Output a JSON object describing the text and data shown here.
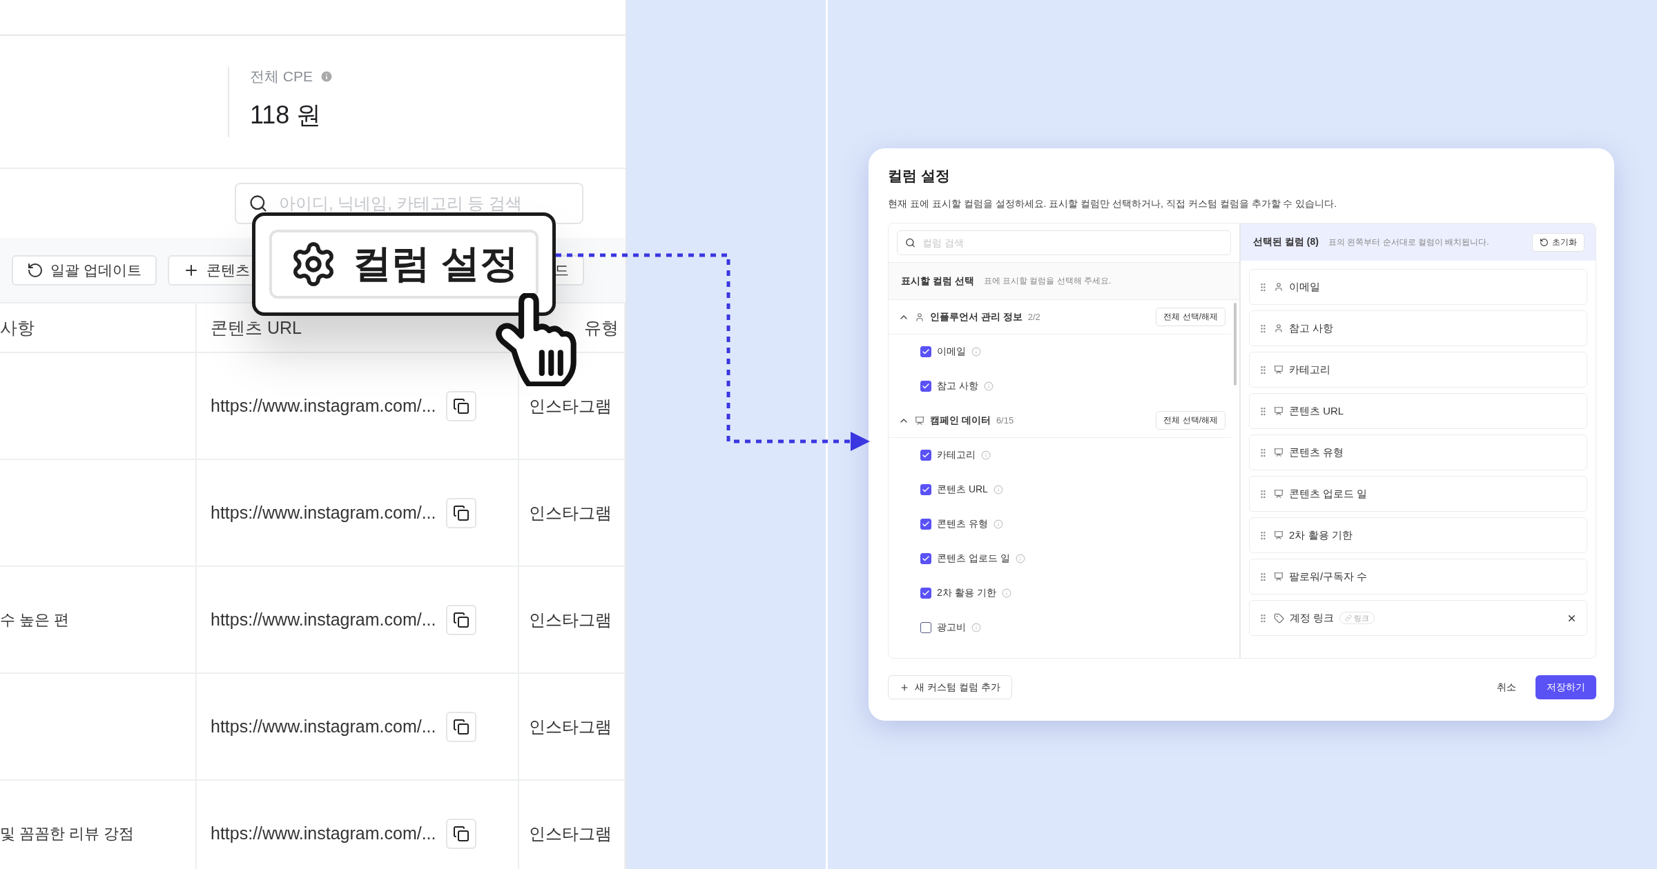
{
  "table_view": {
    "stat": {
      "label": "전체 CPE",
      "value": "118 원"
    },
    "search": {
      "placeholder": "아이디, 닉네임, 카테고리 등 검색"
    },
    "toolbar": [
      {
        "label": "일괄 업데이트",
        "kind": "refresh"
      },
      {
        "label": "콘텐츠",
        "kind": "add"
      },
      {
        "label": "드",
        "kind": "plain"
      }
    ],
    "columns": [
      "사항",
      "콘텐츠 URL",
      "유형"
    ],
    "rows": [
      {
        "url": "https://www.instagram.com/...",
        "type": "인스타그램"
      },
      {
        "url": "https://www.instagram.com/...",
        "type": "인스타그램"
      },
      {
        "note": "수 높은 편",
        "url": "https://www.instagram.com/...",
        "type": "인스타그램"
      },
      {
        "url": "https://www.instagram.com/...",
        "type": "인스타그램"
      },
      {
        "note": "및 꼼꼼한 리뷰 강점",
        "url": "https://www.instagram.com/...",
        "type": "인스타그램"
      }
    ]
  },
  "callout": {
    "label": "컬럼 설정"
  },
  "modal": {
    "title": "컬럼 설정",
    "description": "현재 표에 표시할 컬럼을 설정하세요. 표시할 컬럼만 선택하거나, 직접 커스텀 컬럼을 추가할 수 있습니다.",
    "search": {
      "placeholder": "컬럼 검색"
    },
    "available": {
      "title": "표시할 컬럼 선택",
      "hint": "표에 표시할 컬럼을 선택해 주세요.",
      "groups": [
        {
          "name": "인플루언서 관리 정보",
          "kind": "influencer",
          "count": "2/2",
          "expanded": true,
          "toggle_label": "전체 선택/해제",
          "items": [
            {
              "label": "이메일",
              "checked": true
            },
            {
              "label": "참고 사항",
              "checked": true
            }
          ]
        },
        {
          "name": "캠페인 데이터",
          "kind": "campaign",
          "count": "6/15",
          "expanded": true,
          "toggle_label": "전체 선택/해제",
          "items": [
            {
              "label": "카테고리",
              "checked": true
            },
            {
              "label": "콘텐츠 URL",
              "checked": true
            },
            {
              "label": "콘텐츠 유형",
              "checked": true
            },
            {
              "label": "콘텐츠 업로드 일",
              "checked": true
            },
            {
              "label": "2차 활용 기한",
              "checked": true
            },
            {
              "label": "광고비",
              "checked": false
            }
          ]
        }
      ]
    },
    "selected": {
      "title": "선택된 컬럼 (8)",
      "hint": "표의 왼쪽부터 순서대로 컬럼이 배치됩니다.",
      "reset_label": "초기화",
      "items": [
        {
          "label": "이메일",
          "kind": "influencer"
        },
        {
          "label": "참고 사항",
          "kind": "influencer"
        },
        {
          "label": "카테고리",
          "kind": "campaign"
        },
        {
          "label": "콘텐츠 URL",
          "kind": "campaign"
        },
        {
          "label": "콘텐츠 유형",
          "kind": "campaign"
        },
        {
          "label": "콘텐츠 업로드 일",
          "kind": "campaign"
        },
        {
          "label": "2차 활용 기한",
          "kind": "campaign"
        },
        {
          "label": "팔로워/구독자 수",
          "kind": "campaign"
        },
        {
          "label": "계정 링크",
          "kind": "custom",
          "badge": "링크",
          "removable": true
        }
      ]
    },
    "add_button": "새 커스텀 컬럼 추가",
    "cancel": "취소",
    "save": "저장하기"
  }
}
